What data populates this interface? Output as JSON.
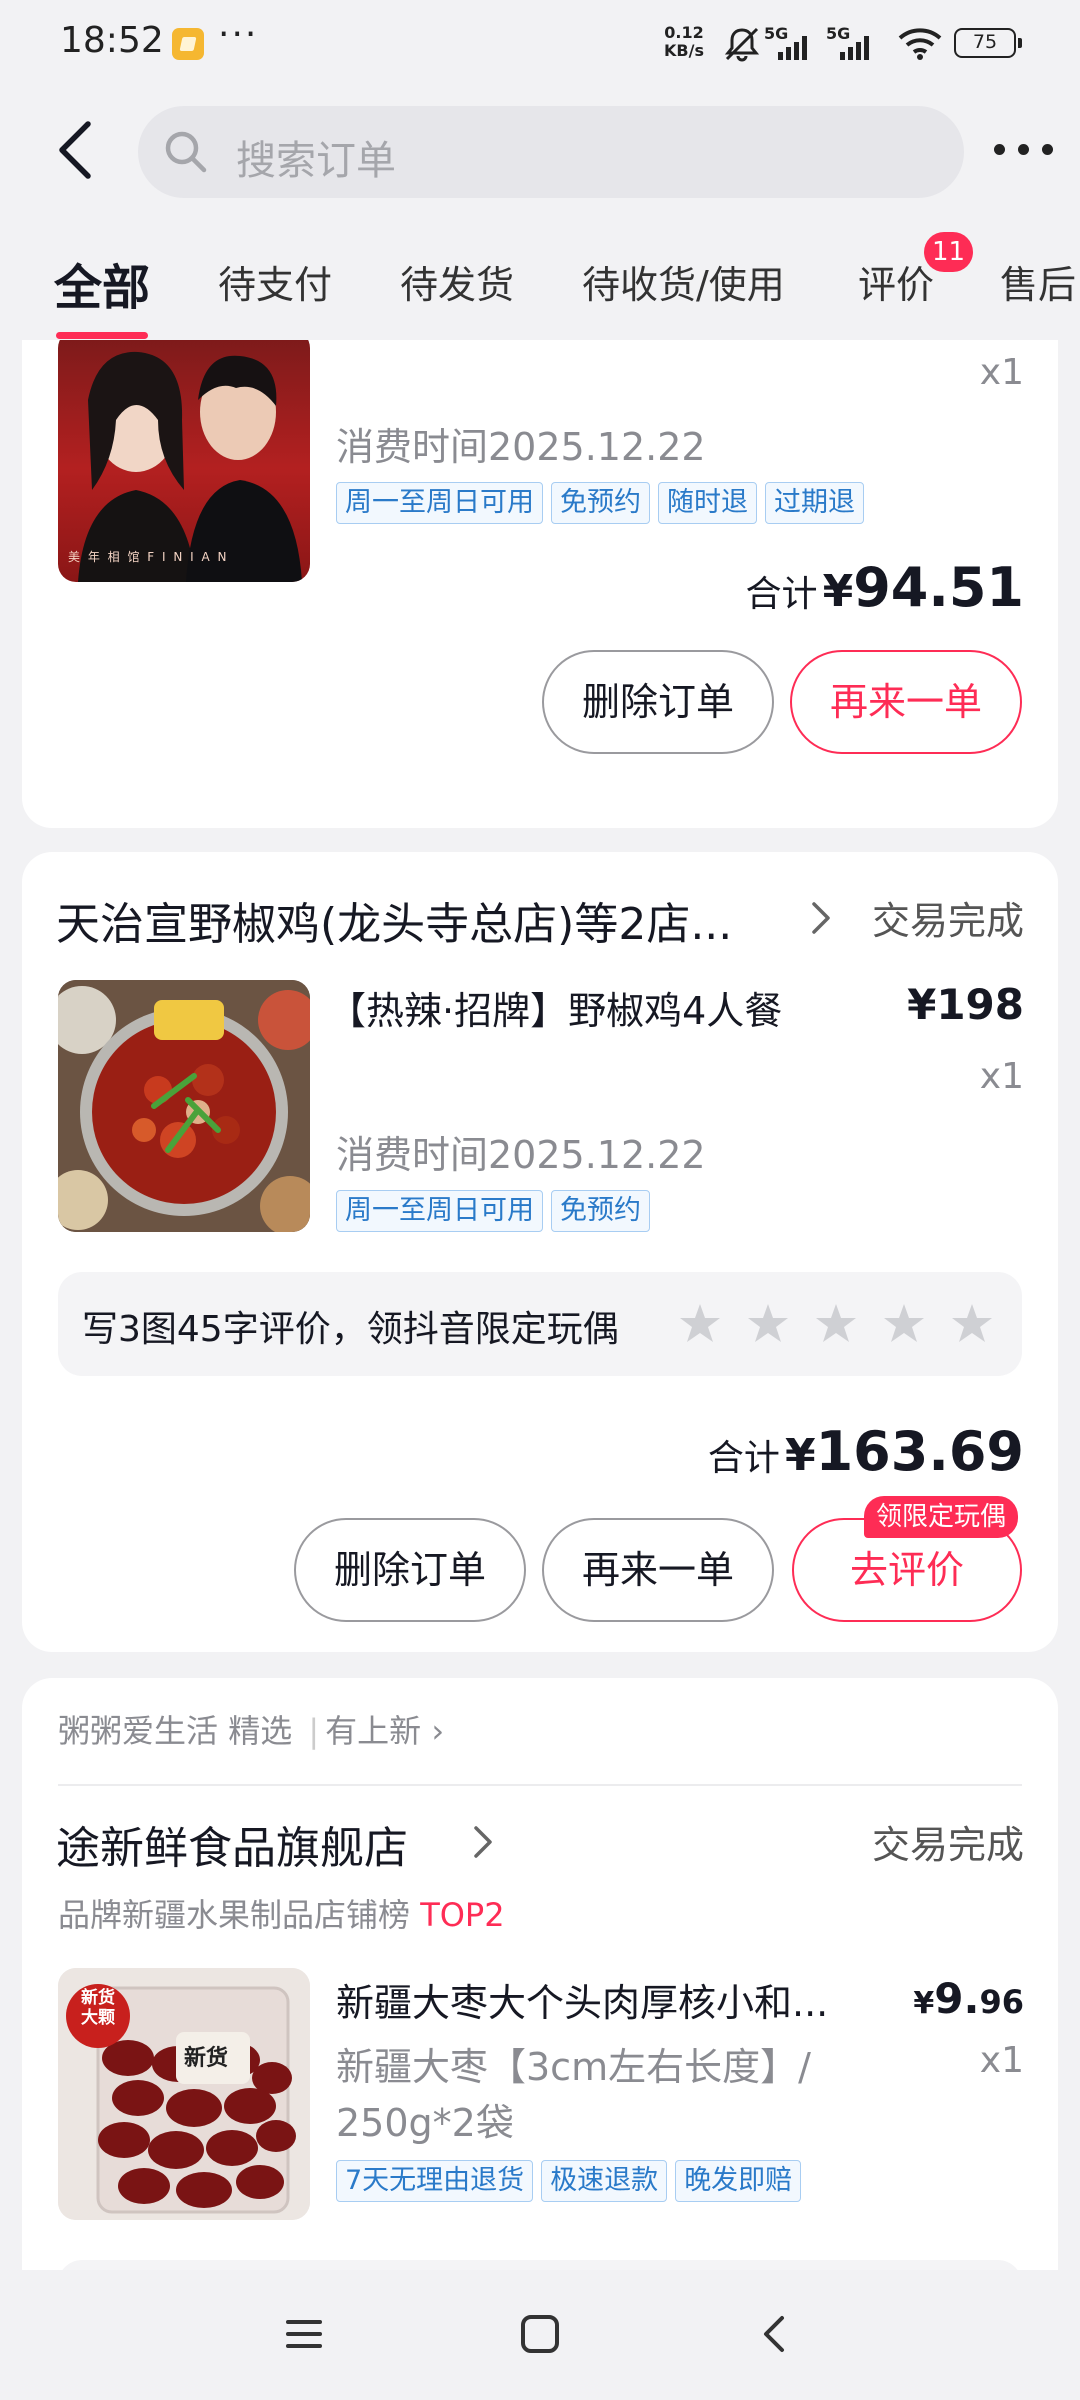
{
  "status_bar": {
    "time": "18:52",
    "speed_top": "0.12",
    "speed_bottom": "KB/s",
    "sig1": "5G",
    "sig2": "5G",
    "battery": "75"
  },
  "header": {
    "search_placeholder": "搜索订单"
  },
  "tabs": [
    {
      "label": "全部",
      "active": true
    },
    {
      "label": "待支付"
    },
    {
      "label": "待发货"
    },
    {
      "label": "待收货/使用"
    },
    {
      "label": "评价",
      "badge": "11"
    },
    {
      "label": "售后"
    }
  ],
  "orders": [
    {
      "qty": "x1",
      "consume_time": "消费时间2025.12.22",
      "tags": [
        "周一至周日可用",
        "免预约",
        "随时退",
        "过期退"
      ],
      "thumb_caption": "美 年 相 馆   F I N I A N",
      "total_label": "合计",
      "total_currency": "¥",
      "total_value": "94.51",
      "buttons": [
        "删除订单",
        "再来一单"
      ]
    },
    {
      "shop": "天治宣野椒鸡(龙头寺总店)等2店...",
      "status": "交易完成",
      "product": "【热辣·招牌】野椒鸡4人餐",
      "price": "¥198",
      "qty": "x1",
      "consume_time": "消费时间2025.12.22",
      "tags": [
        "周一至周日可用",
        "免预约"
      ],
      "review_prompt": "写3图45字评价，领抖音限定玩偶",
      "total_label": "合计",
      "total_currency": "¥",
      "total_value": "163.69",
      "buttons": [
        "删除订单",
        "再来一单",
        "去评价"
      ],
      "review_badge": "领限定玩偶"
    },
    {
      "recommend_source": "粥粥爱生活",
      "recommend_tag1": "精选",
      "recommend_tag2": "有上新",
      "shop": "途新鲜食品旗舰店",
      "status": "交易完成",
      "rank_text": "品牌新疆水果制品店铺榜",
      "rank_value": "TOP2",
      "product": "新疆大枣大个头肉厚核小和...",
      "price_symbol": "¥",
      "price_int": "9.",
      "price_dec": "96",
      "qty": "x1",
      "spec_line1": "新疆大枣【3cm左右长度】/",
      "spec_line2": "250g*2袋",
      "tags": [
        "7天无理由退货",
        "极速退款",
        "晚发即赔"
      ],
      "thumb_badge": "新货\n大颗",
      "thumb_label": "新货"
    }
  ],
  "colors": {
    "accent": "#fe2c55",
    "tag_blue": "#2a7ac9",
    "background": "#f2f2f4"
  }
}
